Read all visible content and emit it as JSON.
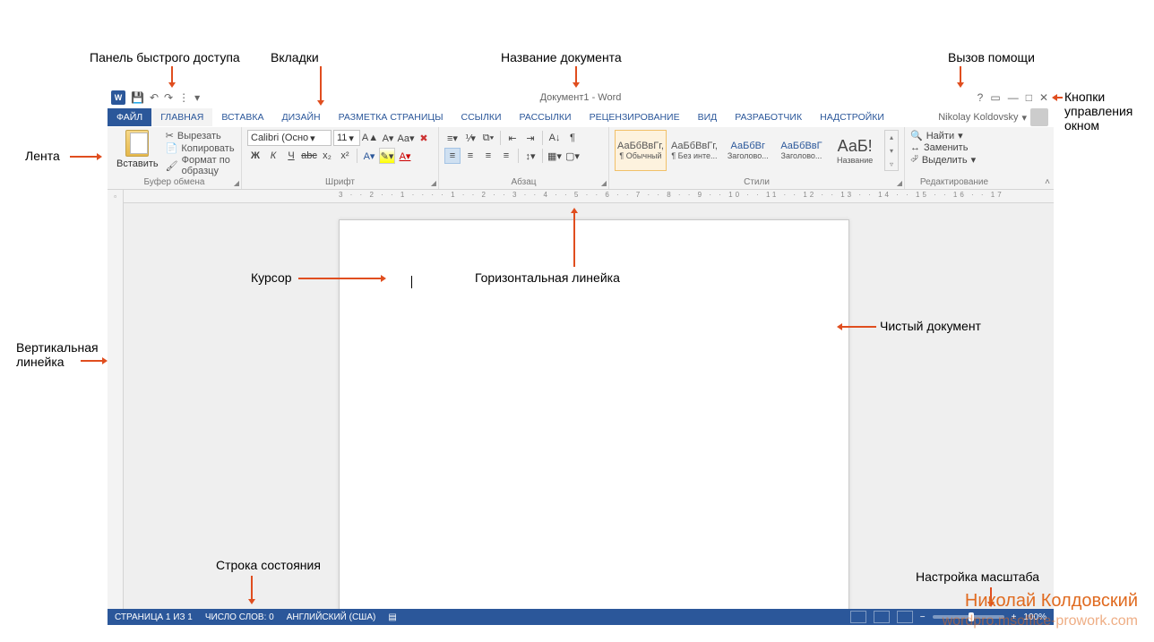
{
  "annotations": {
    "qat": "Панель быстрого доступа",
    "tabs": "Вкладки",
    "doctitle": "Название документа",
    "help": "Вызов помощи",
    "winbtns": "Кнопки управления окном",
    "ribbon": "Лента",
    "cursor": "Курсор",
    "hruler": "Горизонтальная линейка",
    "vruler": "Вертикальная линейка",
    "blankdoc": "Чистый документ",
    "statusbar": "Строка состояния",
    "zoom": "Настройка масштаба"
  },
  "title": "Документ1 - Word",
  "user": "Nikolay Koldovsky",
  "tabs": {
    "file": "ФАЙЛ",
    "home": "ГЛАВНАЯ",
    "insert": "ВСТАВКА",
    "design": "ДИЗАЙН",
    "layout": "РАЗМЕТКА СТРАНИЦЫ",
    "references": "ССЫЛКИ",
    "mailings": "РАССЫЛКИ",
    "review": "РЕЦЕНЗИРОВАНИЕ",
    "view": "ВИД",
    "developer": "РАЗРАБОТЧИК",
    "addins": "НАДСТРОЙКИ"
  },
  "clipboard": {
    "paste": "Вставить",
    "cut": "Вырезать",
    "copy": "Копировать",
    "formatpainter": "Формат по образцу",
    "label": "Буфер обмена"
  },
  "font": {
    "name": "Calibri (Осно",
    "size": "11",
    "label": "Шрифт",
    "bold": "Ж",
    "italic": "К",
    "underline": "Ч",
    "strike": "abc",
    "sub": "x₂",
    "sup": "x²"
  },
  "paragraph": {
    "label": "Абзац"
  },
  "styles": {
    "label": "Стили",
    "items": [
      {
        "preview": "АаБбВвГг,",
        "name": "¶ Обычный"
      },
      {
        "preview": "АаБбВвГг,",
        "name": "¶ Без инте..."
      },
      {
        "preview": "АаБбВг",
        "name": "Заголово..."
      },
      {
        "preview": "АаБбВвГ",
        "name": "Заголово..."
      },
      {
        "preview": "АаБ!",
        "name": "Название"
      }
    ]
  },
  "editing": {
    "find": "Найти",
    "replace": "Заменить",
    "select": "Выделить",
    "label": "Редактирование"
  },
  "ruler_marks": "3 · · 2 · · 1 · · · · 1 · · 2 · · 3 · · 4 · · 5 · · 6 · · 7 · · 8 · · 9 · · 10 · · 11 · · 12 · · 13 · · 14 · · 15 · · 16 · · 17",
  "status": {
    "page": "СТРАНИЦА 1 ИЗ 1",
    "words": "ЧИСЛО СЛОВ: 0",
    "lang": "АНГЛИЙСКИЙ (США)",
    "zoom": "100%"
  },
  "watermark": {
    "name": "Николай Колдовский",
    "url": "wordpro.msoffice-prowork.com"
  }
}
